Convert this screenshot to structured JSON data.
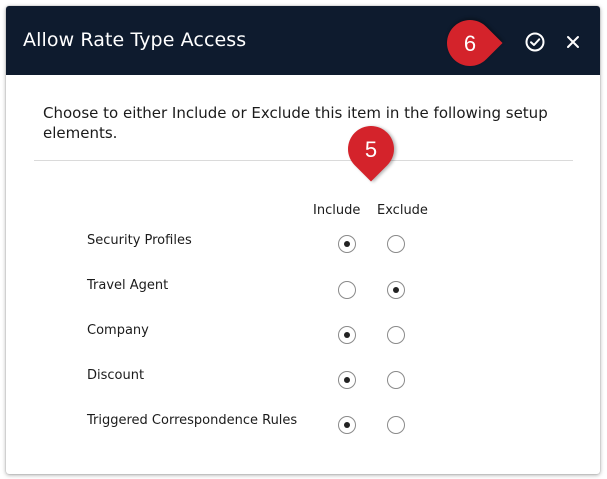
{
  "dialog": {
    "title": "Allow Rate Type Access",
    "description": "Choose to either Include or Exclude this item in the following setup elements.",
    "save_icon": "check-circle-icon",
    "close_icon": "close-icon"
  },
  "columns": {
    "include": "Include",
    "exclude": "Exclude"
  },
  "rows": [
    {
      "label": "Security Profiles",
      "selected": "include"
    },
    {
      "label": "Travel Agent",
      "selected": "exclude"
    },
    {
      "label": "Company",
      "selected": "include"
    },
    {
      "label": "Discount",
      "selected": "include"
    },
    {
      "label": "Triggered Correspondence Rules",
      "selected": "include"
    }
  ],
  "callouts": {
    "step_6": "6",
    "step_5": "5"
  },
  "colors": {
    "header_bg": "#0e1b2e",
    "callout": "#d4232b"
  }
}
